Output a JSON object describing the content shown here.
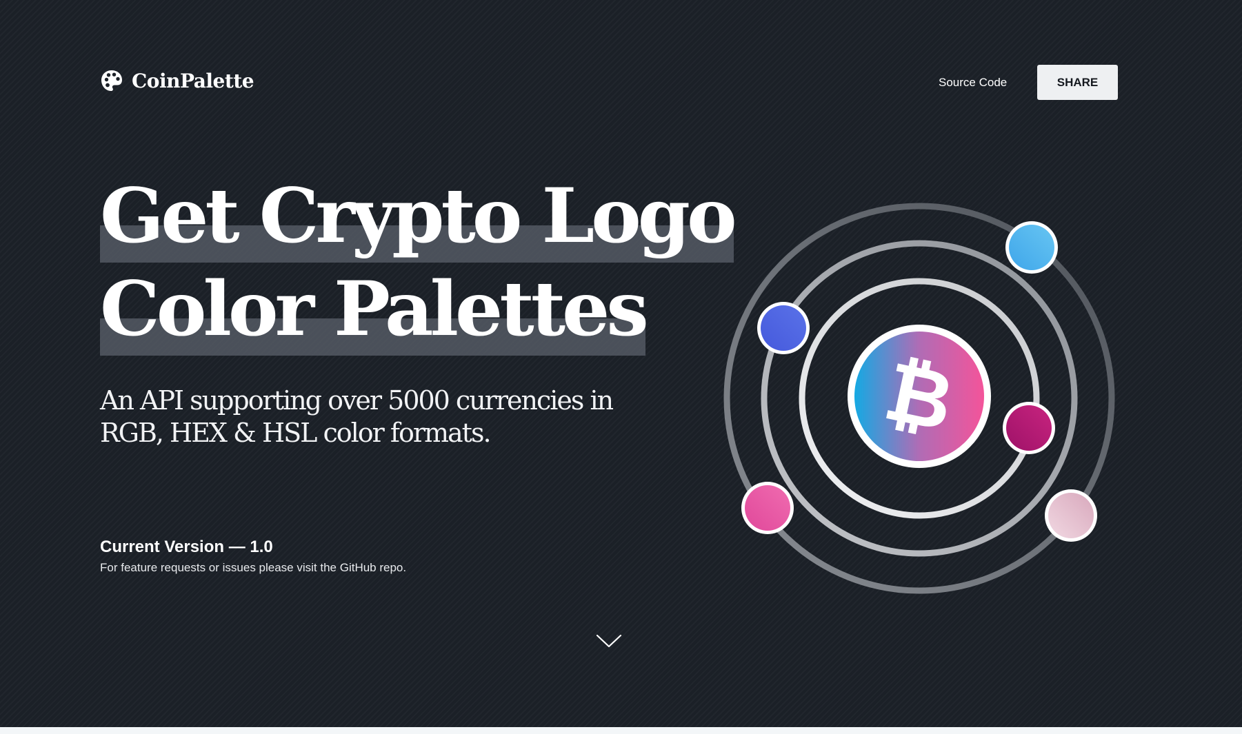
{
  "brand": {
    "name": "CoinPalette",
    "icon": "palette-icon"
  },
  "nav": {
    "source_code_label": "Source Code",
    "share_label": "SHARE"
  },
  "hero": {
    "headline_line1": "Get Crypto Logo",
    "headline_line2": "Color Palettes",
    "subheadline": "An API supporting over 5000 currencies in RGB, HEX & HSL color formats.",
    "version_title": "Current Version — 1.0",
    "version_note": "For feature requests or issues please visit the GitHub repo."
  },
  "illustration": {
    "center_icon": "bitcoin-icon",
    "palette_colors": [
      "#55b6ee",
      "#4f66e2",
      "#b31a77",
      "#ea5aa5",
      "#e9c6d4"
    ],
    "coin_gradient": [
      "#14a9e3",
      "#b06cb5",
      "#f4549a"
    ]
  },
  "scroll_icon": "chevron-down-icon"
}
